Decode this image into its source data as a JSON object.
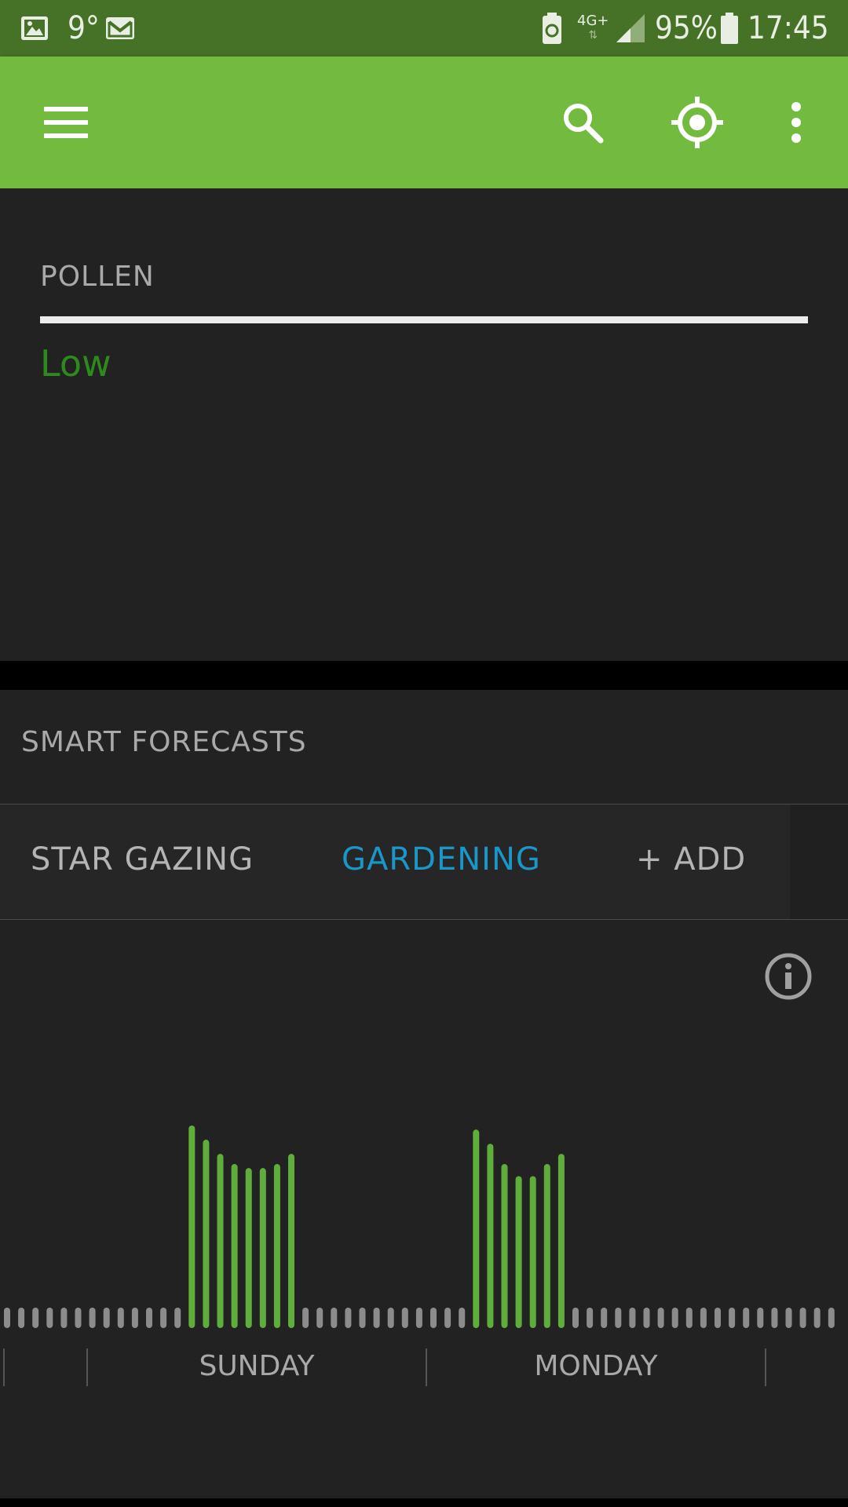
{
  "status_bar": {
    "temperature": "9°",
    "network": "4G+",
    "battery": "95%",
    "time": "17:45",
    "icons": [
      "image-icon",
      "gmail-icon",
      "battery-saver-icon",
      "signal-icon",
      "battery-icon"
    ]
  },
  "app_bar": {
    "icons": [
      "menu-icon",
      "search-icon",
      "locate-icon",
      "more-vert-icon"
    ],
    "color": "#72bb3e"
  },
  "pollen": {
    "title": "POLLEN",
    "level": "Low",
    "level_color": "#2d8a1c"
  },
  "smart_forecasts": {
    "title": "SMART FORECASTS",
    "tabs": [
      {
        "label": "STAR GAZING",
        "selected": false
      },
      {
        "label": "GARDENING",
        "selected": true
      },
      {
        "label": "+ ADD",
        "selected": false
      }
    ],
    "selected_color": "#1a96c8"
  },
  "chart_data": {
    "type": "bar",
    "x": [
      "SUNDAY",
      "MONDAY"
    ],
    "bar_color": "#5fae3c",
    "baseline_color": "#8c8c8c",
    "groups": [
      {
        "day": "SUNDAY",
        "values": [
          1.0,
          0.93,
          0.86,
          0.81,
          0.79,
          0.79,
          0.81,
          0.86
        ]
      },
      {
        "day": "MONDAY",
        "values": [
          0.98,
          0.91,
          0.81,
          0.75,
          0.75,
          0.81,
          0.86
        ]
      }
    ]
  }
}
